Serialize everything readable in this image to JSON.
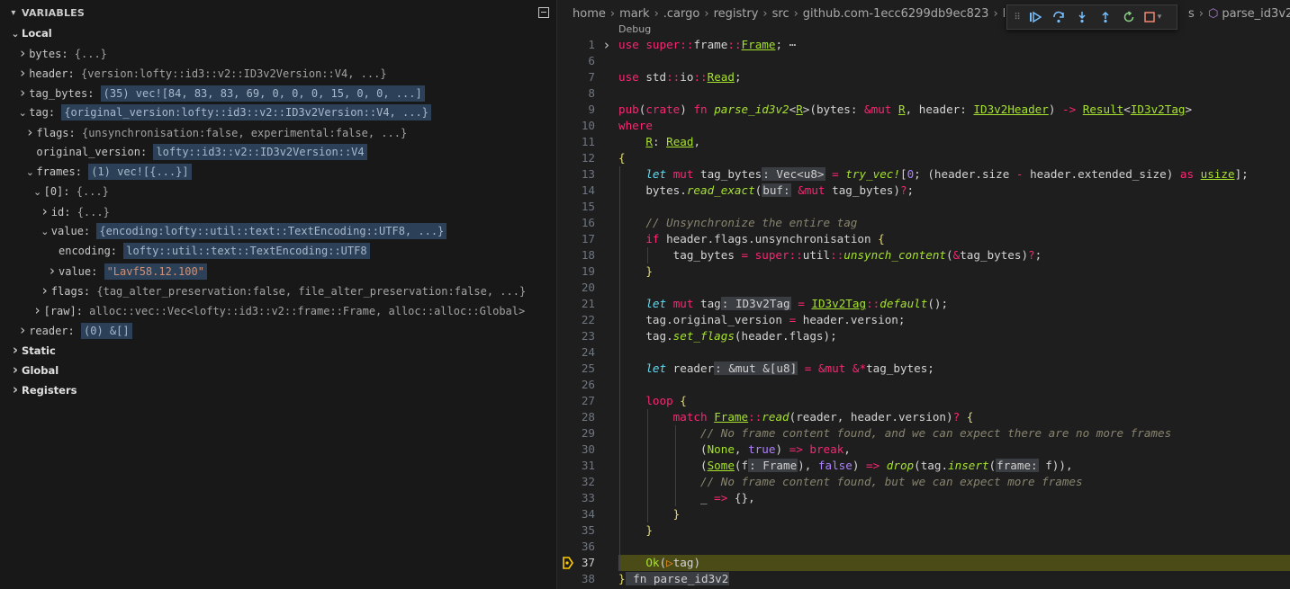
{
  "variables_panel": {
    "title": "VARIABLES",
    "rows": [
      {
        "indent": 0,
        "twisty": "v",
        "name": "Local",
        "section": true
      },
      {
        "indent": 1,
        "twisty": ">",
        "name": "bytes",
        "value": "{...}"
      },
      {
        "indent": 1,
        "twisty": ">",
        "name": "header",
        "value": "{version:lofty::id3::v2::ID3v2Version::V4, ...}"
      },
      {
        "indent": 1,
        "twisty": ">",
        "name": "tag_bytes",
        "value": "(35) vec![84, 83, 83, 69, 0, 0, 0, 15, 0, 0, ...]",
        "hl": true
      },
      {
        "indent": 1,
        "twisty": "v",
        "name": "tag",
        "value": "{original_version:lofty::id3::v2::ID3v2Version::V4, ...}",
        "hl": true
      },
      {
        "indent": 2,
        "twisty": ">",
        "name": "flags",
        "value": "{unsynchronisation:false, experimental:false, ...}"
      },
      {
        "indent": 2,
        "twisty": "",
        "name": "original_version",
        "value": "lofty::id3::v2::ID3v2Version::V4",
        "hl": true
      },
      {
        "indent": 2,
        "twisty": "v",
        "name": "frames",
        "value": "(1) vec![{...}]",
        "hl": true
      },
      {
        "indent": 3,
        "twisty": "v",
        "name": "[0]",
        "value": "{...}"
      },
      {
        "indent": 4,
        "twisty": ">",
        "name": "id",
        "value": "{...}"
      },
      {
        "indent": 4,
        "twisty": "v",
        "name": "value",
        "value": "{encoding:lofty::util::text::TextEncoding::UTF8, ...}",
        "hl": true
      },
      {
        "indent": 5,
        "twisty": "",
        "name": "encoding",
        "value": "lofty::util::text::TextEncoding::UTF8",
        "hl": true
      },
      {
        "indent": 5,
        "twisty": ">",
        "name": "value",
        "value": "\"Lavf58.12.100\"",
        "str": true
      },
      {
        "indent": 4,
        "twisty": ">",
        "name": "flags",
        "value": "{tag_alter_preservation:false, file_alter_preservation:false, ...}"
      },
      {
        "indent": 3,
        "twisty": ">",
        "name": "[raw]",
        "value": "alloc::vec::Vec<lofty::id3::v2::frame::Frame, alloc::alloc::Global>"
      },
      {
        "indent": 1,
        "twisty": ">",
        "name": "reader",
        "value": "(0) &[]",
        "hl": true
      },
      {
        "indent": 0,
        "twisty": ">",
        "name": "Static",
        "section": true
      },
      {
        "indent": 0,
        "twisty": ">",
        "name": "Global",
        "section": true
      },
      {
        "indent": 0,
        "twisty": ">",
        "name": "Registers",
        "section": true
      }
    ]
  },
  "breadcrumbs": [
    "home",
    "mark",
    ".cargo",
    "registry",
    "src",
    "github.com-1ecc6299db9ec823",
    "lofty-0"
  ],
  "breadcrumb_tail": [
    "s",
    "parse_id3v2"
  ],
  "debug_toolbar": {
    "label": "Debug",
    "buttons": [
      "continue",
      "step-over",
      "step-into",
      "step-out",
      "restart",
      "stop"
    ]
  },
  "editor": {
    "current_line": 37,
    "lines": [
      {
        "n": 1,
        "html": "<span class=\"k\">use</span> <span class=\"k\">super</span><span class=\"op\">::</span>frame<span class=\"op\">::</span><span class=\"ty\">Frame</span>;<span class=\"pu\"> ⋯</span>",
        "fold": ">"
      },
      {
        "n": 6,
        "html": ""
      },
      {
        "n": 7,
        "html": "<span class=\"k\">use</span> std<span class=\"op\">::</span>io<span class=\"op\">::</span><span class=\"ty\">Read</span>;"
      },
      {
        "n": 8,
        "html": ""
      },
      {
        "n": 9,
        "html": "<span class=\"k\">pub</span>(<span class=\"k\">crate</span>) <span class=\"k\">fn</span> <span class=\"fn\">parse_id3v2</span>&lt;<span class=\"ty\">R</span>&gt;(bytes: <span class=\"op\">&amp;mut</span> <span class=\"ty\">R</span>, header: <span class=\"ty\">ID3v2Header</span>) <span class=\"op\">-&gt;</span> <span class=\"ty\">Result</span>&lt;<span class=\"ty\">ID3v2Tag</span>&gt;"
      },
      {
        "n": 10,
        "html": "<span class=\"k\">where</span>"
      },
      {
        "n": 11,
        "html": "    <span class=\"ty\">R</span>: <span class=\"ty\">Read</span>,"
      },
      {
        "n": 12,
        "html": "<span class=\"yl\">{</span>"
      },
      {
        "n": 13,
        "html": "    <span class=\"it\">let</span> <span class=\"k\">mut</span> tag_bytes<span class=\"ih\">: Vec&lt;u8&gt;</span> <span class=\"op\">=</span> <span class=\"fn\">try_vec!</span>[<span class=\"nu\">0</span>; (header.size <span class=\"op\">-</span> header.extended_size) <span class=\"k\">as</span> <span class=\"ty\">usize</span>];"
      },
      {
        "n": 14,
        "html": "    bytes.<span class=\"fn\">read_exact</span>(<span class=\"ih\">buf:</span> <span class=\"op\">&amp;mut</span> tag_bytes)<span class=\"op\">?</span>;"
      },
      {
        "n": 15,
        "html": ""
      },
      {
        "n": 16,
        "html": "    <span class=\"cm\">// Unsynchronize the entire tag</span>"
      },
      {
        "n": 17,
        "html": "    <span class=\"k\">if</span> header.flags.unsynchronisation <span class=\"yl\">{</span>"
      },
      {
        "n": 18,
        "html": "        tag_bytes <span class=\"op\">=</span> <span class=\"k\">super</span><span class=\"op\">::</span>util<span class=\"op\">::</span><span class=\"fn\">unsynch_content</span>(<span class=\"op\">&amp;</span>tag_bytes)<span class=\"op\">?</span>;"
      },
      {
        "n": 19,
        "html": "    <span class=\"yl\">}</span>"
      },
      {
        "n": 20,
        "html": ""
      },
      {
        "n": 21,
        "html": "    <span class=\"it\">let</span> <span class=\"k\">mut</span> tag<span class=\"ih\">: ID3v2Tag</span> <span class=\"op\">=</span> <span class=\"ty\">ID3v2Tag</span><span class=\"op\">::</span><span class=\"fn\">default</span>();"
      },
      {
        "n": 22,
        "html": "    tag.original_version <span class=\"op\">=</span> header.version;"
      },
      {
        "n": 23,
        "html": "    tag.<span class=\"fn\">set_flags</span>(header.flags);"
      },
      {
        "n": 24,
        "html": ""
      },
      {
        "n": 25,
        "html": "    <span class=\"it\">let</span> reader<span class=\"ih\">: &amp;mut &amp;[u8]</span> <span class=\"op\">=</span> <span class=\"op\">&amp;mut</span> <span class=\"op\">&amp;*</span>tag_bytes;"
      },
      {
        "n": 26,
        "html": ""
      },
      {
        "n": 27,
        "html": "    <span class=\"k\">loop</span> <span class=\"yl\">{</span>"
      },
      {
        "n": 28,
        "html": "        <span class=\"k\">match</span> <span class=\"ty\">Frame</span><span class=\"op\">::</span><span class=\"fn\">read</span>(reader, header.version)<span class=\"op\">?</span> <span class=\"yl\">{</span>"
      },
      {
        "n": 29,
        "html": "            <span class=\"cm\">// No frame content found, and we can expect there are no more frames</span>"
      },
      {
        "n": 30,
        "html": "            (<span class=\"t2\">None</span>, <span class=\"nu\">true</span>) <span class=\"op\">=&gt;</span> <span class=\"k\">break</span>,"
      },
      {
        "n": 31,
        "html": "            (<span class=\"ty\">Some</span>(f<span class=\"ih\">: Frame</span>), <span class=\"nu\">false</span>) <span class=\"op\">=&gt;</span> <span class=\"fn\">drop</span>(tag.<span class=\"fn\">insert</span>(<span class=\"ih\">frame:</span> f)),"
      },
      {
        "n": 32,
        "html": "            <span class=\"cm\">// No frame content found, but we can expect more frames</span>"
      },
      {
        "n": 33,
        "html": "            _ <span class=\"op\">=&gt;</span> {},"
      },
      {
        "n": 34,
        "html": "        <span class=\"yl\">}</span>"
      },
      {
        "n": 35,
        "html": "    <span class=\"yl\">}</span>"
      },
      {
        "n": 36,
        "html": ""
      },
      {
        "n": 37,
        "html": "    <span class=\"t2\">Ok</span>(<span class=\"or\">▷</span>tag)"
      },
      {
        "n": 38,
        "html": "<span class=\"yl\">}</span><span class=\"ih\"> fn parse_id3v2</span>"
      }
    ]
  }
}
